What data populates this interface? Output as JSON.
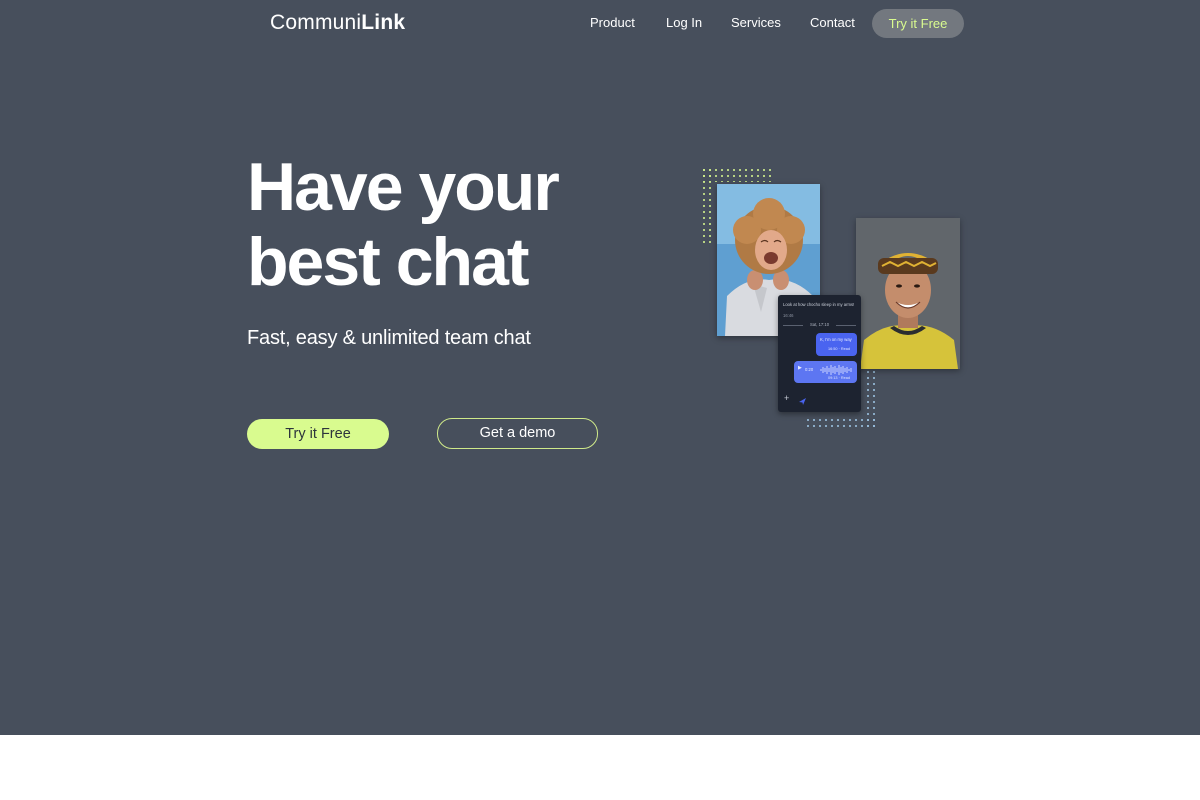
{
  "brand": {
    "name_light": "Communi",
    "name_bold": "Link"
  },
  "nav": {
    "items": [
      "Product",
      "Log In",
      "Services",
      "Contact"
    ],
    "cta": "Try it Free"
  },
  "hero": {
    "headline_line1": "Have your",
    "headline_line2": "best chat",
    "subheadline": "Fast, easy & unlimited team chat",
    "primary_button": "Try it Free",
    "secondary_button": "Get a demo"
  },
  "chat_preview": {
    "question": "Look at how chocho sleep in my arms!",
    "question_time": "16:46",
    "date_divider": "Sat, 17:10",
    "message_text": "K, I'm on my way",
    "message_time": "16:50 · Read",
    "voice_duration": "0:20",
    "voice_time": "09:13 · Read"
  },
  "colors": {
    "background": "#474f5c",
    "accent": "#d9fb8f",
    "chat_bubble": "#4a64f0"
  },
  "icons": [
    "play-icon",
    "plus-icon",
    "send-icon"
  ]
}
